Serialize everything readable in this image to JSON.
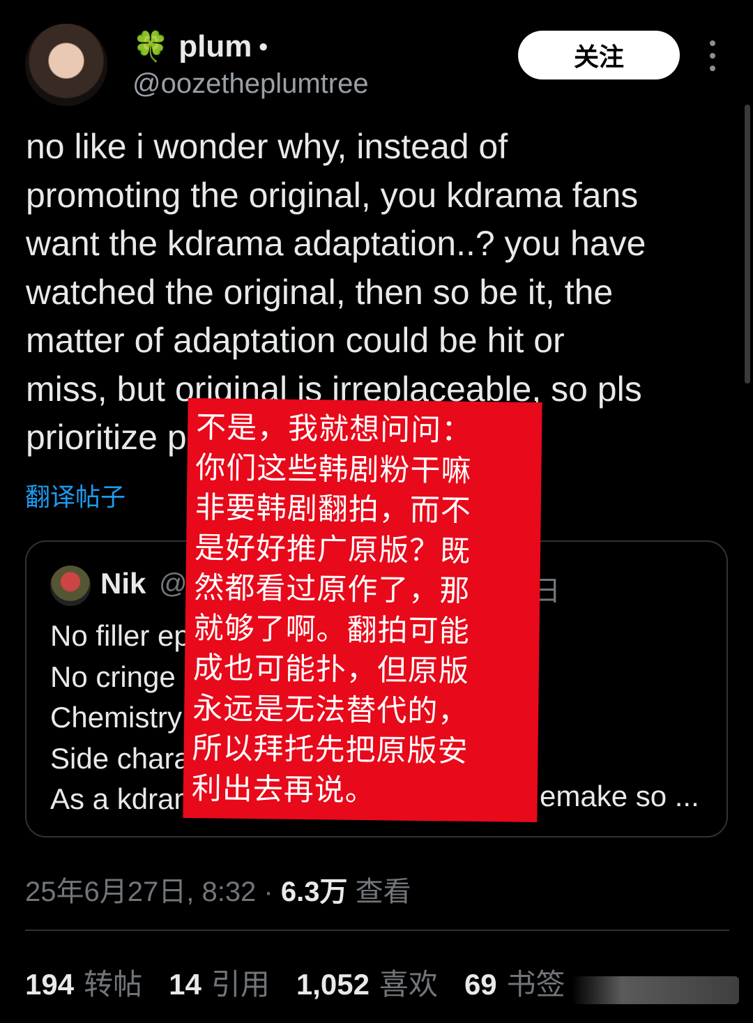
{
  "author": {
    "emoji": "🍀",
    "name": "plum",
    "name_suffix": "•",
    "handle": "@oozetheplumtree"
  },
  "follow_button": "关注",
  "tweet": {
    "text": "no like i wonder why, instead of\npromoting the original, you kdrama fans\nwant the kdrama adaptation..? you have\nwatched the original, then so be it, the\nmatter of adaptation could be hit or\nmiss, but original is irreplaceable, so pls\nprioritize promoting the original."
  },
  "translate_link": "翻译帖子",
  "quote": {
    "name": "Nik",
    "handle": "@A",
    "date_fragment": "日",
    "lines": [
      "No filler ep",
      "No cringe a",
      "Chemistry",
      "Side chara",
      "As a kdram"
    ],
    "tail": "emake so ..."
  },
  "overlay": {
    "text": "不是，我就想问问：\n你们这些韩剧粉干嘛\n非要韩剧翻拍，而不\n是好好推广原版？既\n然都看过原作了，那\n就够了啊。翻拍可能\n成也可能扑，但原版\n永远是无法替代的，\n所以拜托先把原版安\n利出去再说。"
  },
  "meta": {
    "datetime": "25年6月27日, 8:32 · ",
    "views_count": "6.3万",
    "views_label": " 查看"
  },
  "stats": {
    "reposts_count": "194",
    "reposts_label": "转帖",
    "quotes_count": "14",
    "quotes_label": "引用",
    "likes_count": "1,052",
    "likes_label": "喜欢",
    "bookmarks_count": "69",
    "bookmarks_label": "书签"
  }
}
